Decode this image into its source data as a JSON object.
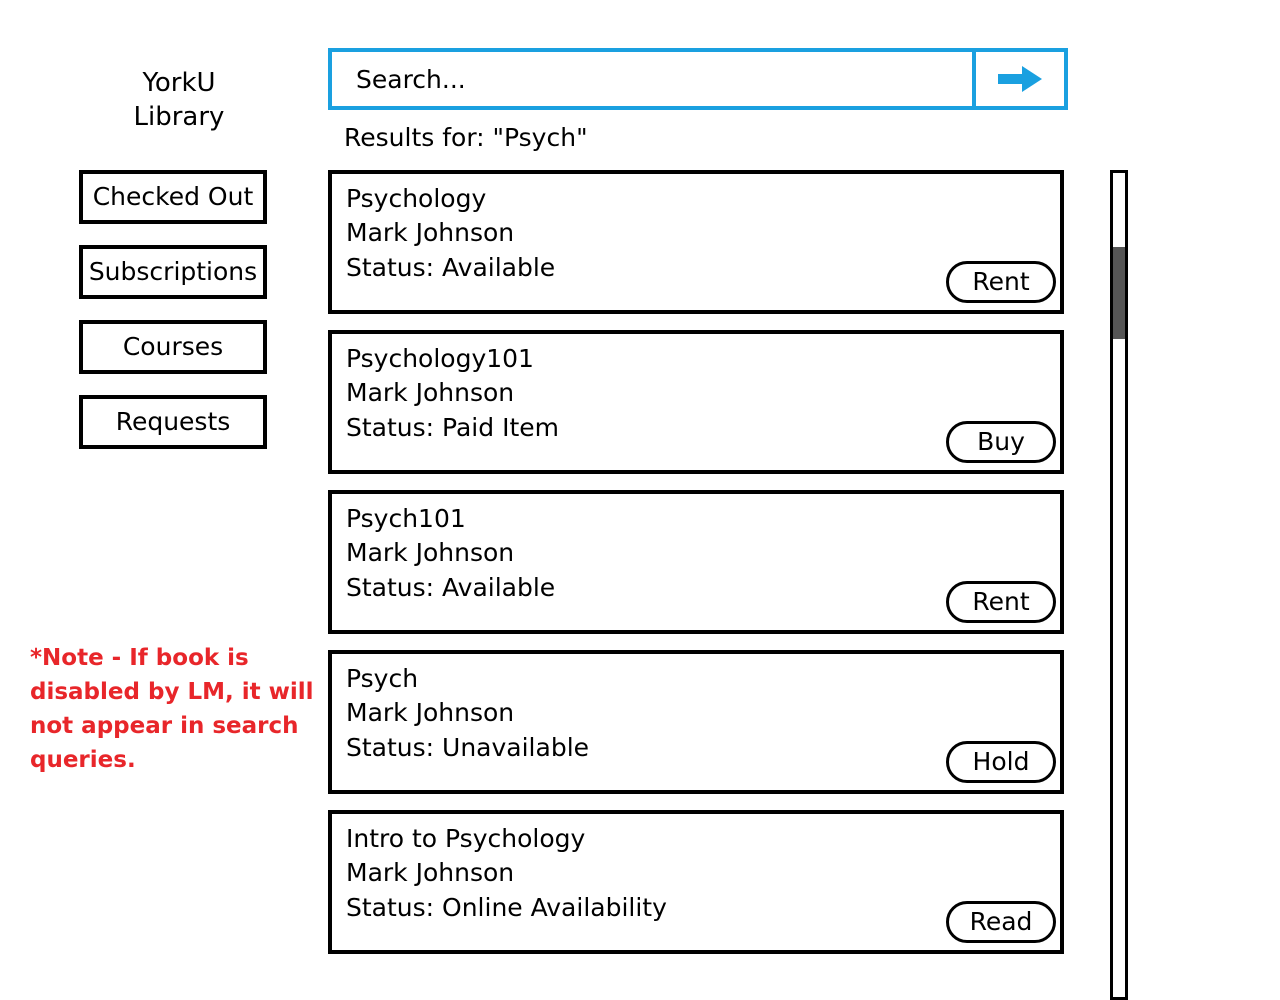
{
  "logo": {
    "line1": "YorkU",
    "line2": "Library"
  },
  "sidebar": {
    "items": [
      {
        "label": "Checked Out"
      },
      {
        "label": "Subscriptions"
      },
      {
        "label": "Courses"
      },
      {
        "label": "Requests"
      }
    ]
  },
  "search": {
    "placeholder": "Search...",
    "submit_icon": "right-arrow-icon"
  },
  "results_header": "Results for: \"Psych\"",
  "results": [
    {
      "title": "Psychology",
      "author": "Mark Johnson",
      "status": "Status: Available",
      "action": "Rent"
    },
    {
      "title": "Psychology101",
      "author": "Mark Johnson",
      "status": "Status: Paid Item",
      "action": "Buy"
    },
    {
      "title": "Psych101",
      "author": "Mark Johnson",
      "status": "Status: Available",
      "action": "Rent"
    },
    {
      "title": "Psych",
      "author": "Mark Johnson",
      "status": "Status: Unavailable",
      "action": "Hold"
    },
    {
      "title": "Intro to Psychology",
      "author": "Mark Johnson",
      "status": "Status: Online Availability",
      "action": "Read"
    }
  ],
  "note": "*Note - If book is disabled by LM, it will not appear in search queries.",
  "colors": {
    "search_border": "#1aa0e0",
    "note_text": "#e8262a"
  }
}
